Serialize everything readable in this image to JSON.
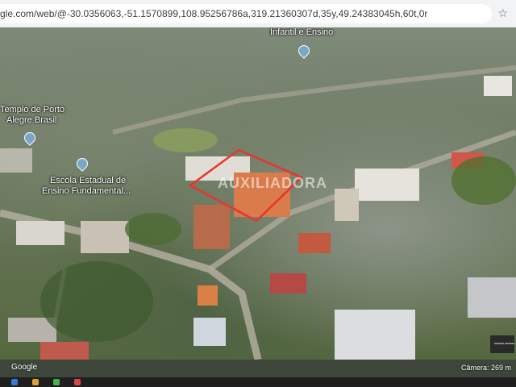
{
  "browser": {
    "url": "gle.com/web/@-30.0356063,-51.1570899,108.95256786a,319.21360307d,35y,49.24383045h,60t,0r"
  },
  "map": {
    "labels": {
      "top_center": "Infantil e Ensino",
      "temple_line1": "Templo de Porto",
      "temple_line2": "Alegre Brasil",
      "school_line1": "Escola Estadual de",
      "school_line2": "Ensino Fundamental..."
    },
    "watermark": "AUXILIADORA",
    "highlight_color": "#e8352e"
  },
  "footer": {
    "attribution": "Google",
    "camera": "Câmera: 269 m"
  }
}
